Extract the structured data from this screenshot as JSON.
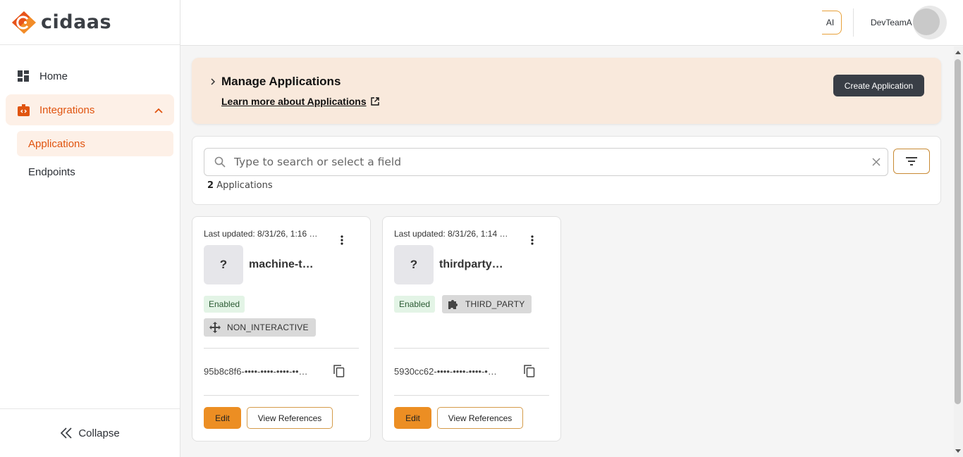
{
  "brand": {
    "name": "cidaas",
    "accent": "#e0540f"
  },
  "sidebar": {
    "items": [
      {
        "label": "Home",
        "icon": "dashboard-icon"
      },
      {
        "label": "Integrations",
        "icon": "integrations-icon",
        "expanded": true
      }
    ],
    "subitems": [
      {
        "label": "Applications",
        "active": true
      },
      {
        "label": "Endpoints",
        "active": false
      }
    ],
    "collapse_label": "Collapse"
  },
  "topbar": {
    "ai_label": "AI",
    "user_name": "DevTeamA"
  },
  "banner": {
    "title": "Manage Applications",
    "link": "Learn more about Applications",
    "create_button": "Create Application"
  },
  "search": {
    "placeholder": "Type to search or select a field",
    "count_number": "2",
    "count_label": "Applications"
  },
  "cards": [
    {
      "updated": "Last updated: 8/31/26, 1:16 …",
      "name": "machine-t…",
      "status": "Enabled",
      "type": "NON_INTERACTIVE",
      "type_icon": "move-arrows-icon",
      "client_id": "95b8c8f6-••••-••••-••••-••…",
      "edit": "Edit",
      "references": "View References"
    },
    {
      "updated": "Last updated: 8/31/26, 1:14 …",
      "name": "thirdparty…",
      "status": "Enabled",
      "type": "THIRD_PARTY",
      "type_icon": "puzzle-icon",
      "client_id": "5930cc62-••••-••••-••••-•…",
      "edit": "Edit",
      "references": "View References"
    }
  ]
}
